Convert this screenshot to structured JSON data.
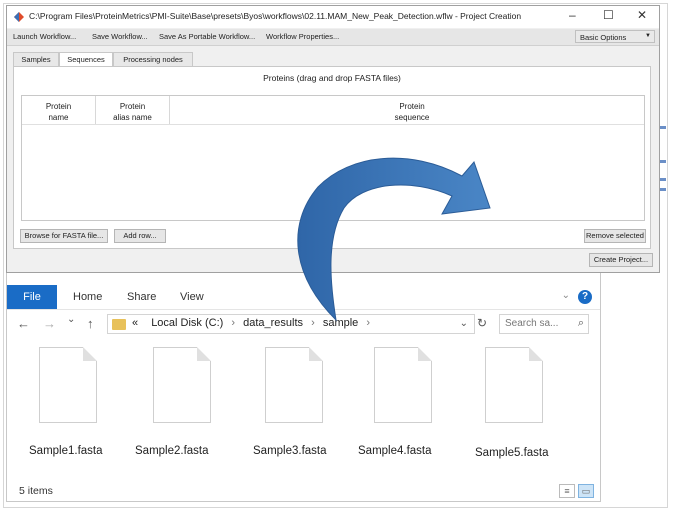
{
  "project_window": {
    "title": "C:\\Program Files\\ProteinMetrics\\PMI-Suite\\Base\\presets\\Byos\\workflows\\02.11.MAM_New_Peak_Detection.wflw - Project Creation",
    "controls": {
      "minimize": "–",
      "maximize": "☐",
      "close": "✕"
    },
    "menu": [
      "Launch Workflow...",
      "Save Workflow...",
      "Save As Portable Workflow...",
      "Workflow Properties..."
    ],
    "options_select": "Basic Options",
    "tabs": [
      "Samples",
      "Sequences",
      "Processing nodes"
    ],
    "active_tab": "Sequences",
    "panel_heading": "Proteins (drag and drop FASTA files)",
    "columns": [
      {
        "line1": "Protein",
        "line2": "name"
      },
      {
        "line1": "Protein",
        "line2": "alias name"
      },
      {
        "line1": "Protein",
        "line2": "sequence"
      }
    ],
    "buttons": {
      "browse": "Browse for FASTA file...",
      "add_row": "Add row...",
      "remove_selected": "Remove selected",
      "create_project": "Create Project..."
    }
  },
  "explorer": {
    "ribbon_tabs": [
      "File",
      "Home",
      "Share",
      "View"
    ],
    "nav": {
      "back": "←",
      "forward": "→",
      "recent": "⌄",
      "up": "↑"
    },
    "address": {
      "prefix": "«",
      "crumbs": [
        "Local Disk (C:)",
        "data_results",
        "sample"
      ]
    },
    "search_placeholder": "Search sa...",
    "files": [
      "Sample1.fasta",
      "Sample2.fasta",
      "Sample3.fasta",
      "Sample4.fasta",
      "Sample5.fasta"
    ],
    "status": "5 items"
  },
  "colors": {
    "file_tab": "#1a6cc6",
    "arrow": "#3d78b8",
    "folder": "#e8c15a"
  },
  "icons": [
    "app-icon",
    "help-icon",
    "folder-icon",
    "refresh-icon",
    "search-icon",
    "file-icon",
    "details-view-icon",
    "large-icons-view-icon"
  ]
}
